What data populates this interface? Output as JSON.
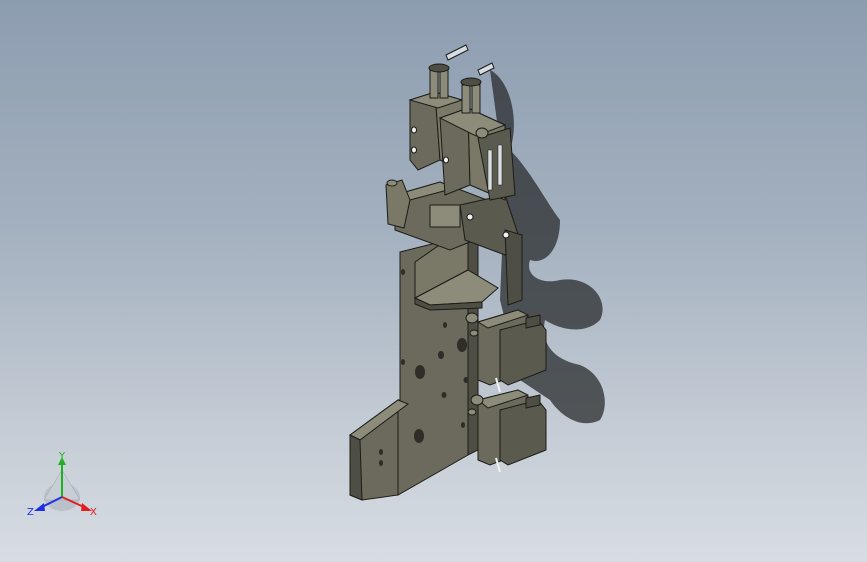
{
  "viewport": {
    "background_top": "#8d9db0",
    "background_bottom": "#d8dde3"
  },
  "model": {
    "body_color": "#6b6a5c",
    "face_light": "#8d8b79",
    "face_dark": "#4f4e44",
    "edge_color": "#1c1c18",
    "shadow_color": "#2a2c2e",
    "accent_white": "#f2f2f2"
  },
  "triad": {
    "x_label": "X",
    "y_label": "Y",
    "z_label": "Z",
    "x_color": "#e02020",
    "y_color": "#20b020",
    "z_color": "#2030e0"
  }
}
